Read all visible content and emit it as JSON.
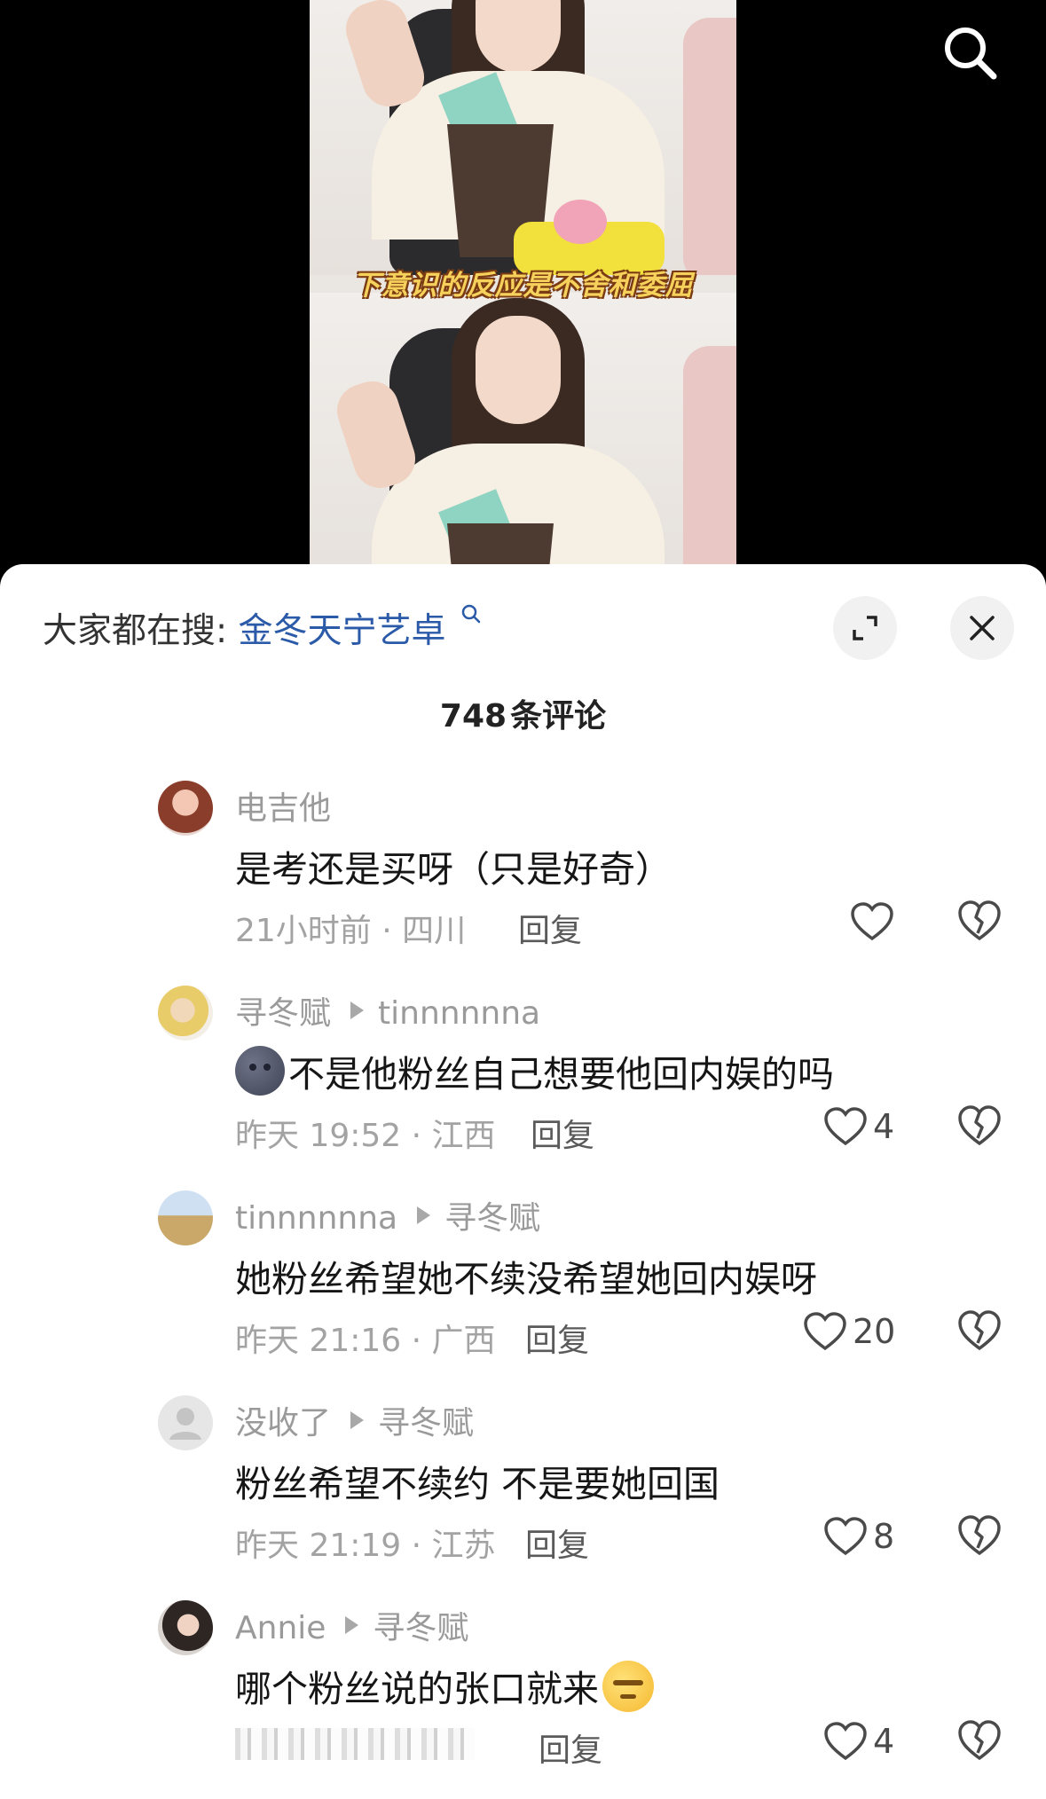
{
  "video": {
    "caption": "下意识的反应是不舍和委屈"
  },
  "sheet": {
    "hot_search_prefix": "大家都在搜:",
    "hot_search_keyword": "金冬天宁艺卓",
    "comment_count": "748",
    "comment_count_suffix": "条评论",
    "reply_label": "回复"
  },
  "comments": [
    {
      "username": "电吉他",
      "reply_to": "",
      "text": "是考还是买呀（只是好奇）",
      "time_location": "21小时前 · 四川",
      "likes": ""
    },
    {
      "username": "寻冬赋",
      "reply_to": "tinnnnnna",
      "text": "不是他粉丝自己想要他回内娱的吗",
      "emoji": "new-moon-face",
      "time_location": "昨天 19:52 · 江西",
      "likes": "4"
    },
    {
      "username": "tinnnnnna",
      "reply_to": "寻冬赋",
      "text": "她粉丝希望她不续没希望她回内娱呀",
      "time_location": "昨天 21:16 · 广西",
      "likes": "20"
    },
    {
      "username": "没收了",
      "reply_to": "寻冬赋",
      "text": "粉丝希望不续约 不是要她回国",
      "time_location": "昨天 21:19 · 江苏",
      "likes": "8"
    },
    {
      "username": "Annie",
      "reply_to": "寻冬赋",
      "text": "哪个粉丝说的张口就来",
      "emoji": "smug-face",
      "time_location": "",
      "likes": "4"
    }
  ],
  "colors": {
    "keyword_blue": "#2b5aa8",
    "caption_yellow": "#f6d15b"
  }
}
